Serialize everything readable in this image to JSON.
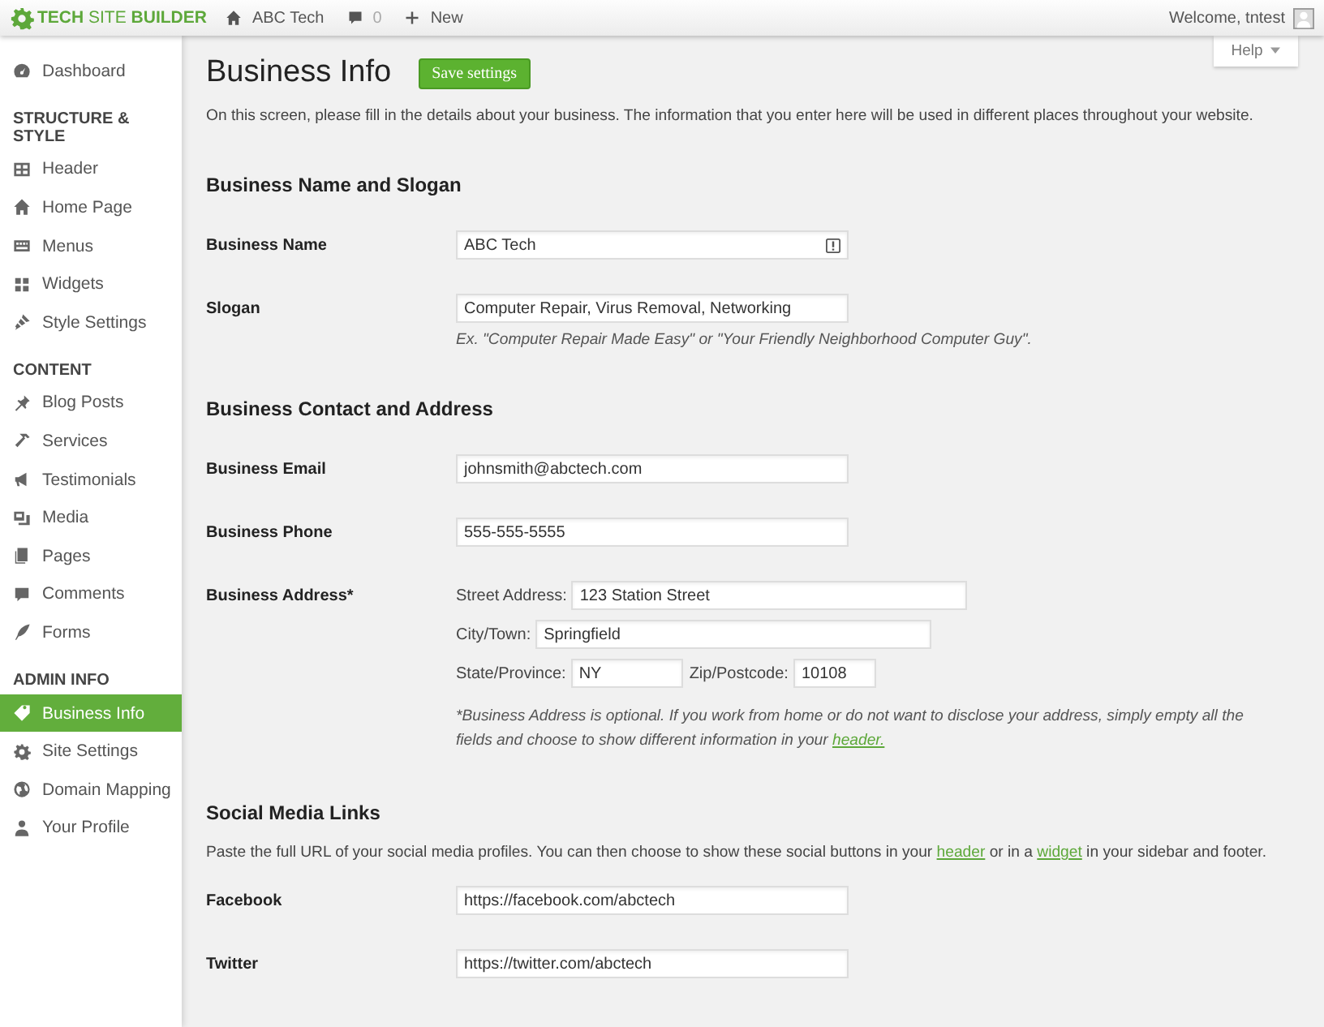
{
  "topbar": {
    "logo": "**TECH** SITE **BUILDER**",
    "site": "ABC Tech",
    "comments": "0",
    "new": "New",
    "welcome": "Welcome, tntest"
  },
  "help": "Help",
  "sidebar": {
    "items": [
      {
        "kind": "link",
        "label": "Dashboard",
        "selected": false
      },
      {
        "kind": "heading",
        "label": "STRUCTURE & STYLE"
      },
      {
        "kind": "link",
        "label": "Header",
        "selected": false
      },
      {
        "kind": "link",
        "label": "Home Page",
        "selected": false
      },
      {
        "kind": "link",
        "label": "Menus",
        "selected": false
      },
      {
        "kind": "link",
        "label": "Widgets",
        "selected": false
      },
      {
        "kind": "link",
        "label": "Style Settings",
        "selected": false
      },
      {
        "kind": "heading",
        "label": "CONTENT"
      },
      {
        "kind": "link",
        "label": "Blog Posts",
        "selected": false
      },
      {
        "kind": "link",
        "label": "Services",
        "selected": false
      },
      {
        "kind": "link",
        "label": "Testimonials",
        "selected": false
      },
      {
        "kind": "link",
        "label": "Media",
        "selected": false
      },
      {
        "kind": "link",
        "label": "Pages",
        "selected": false
      },
      {
        "kind": "link",
        "label": "Comments",
        "selected": false
      },
      {
        "kind": "link",
        "label": "Forms",
        "selected": false
      },
      {
        "kind": "heading",
        "label": "ADMIN INFO"
      },
      {
        "kind": "link",
        "label": "Business Info",
        "selected": true
      },
      {
        "kind": "link",
        "label": "Site Settings",
        "selected": false
      },
      {
        "kind": "link",
        "label": "Domain Mapping",
        "selected": false
      },
      {
        "kind": "link",
        "label": "Your Profile",
        "selected": false
      }
    ]
  },
  "page": {
    "title": "Business Info",
    "save_button": "Save settings",
    "intro": "On this screen, please fill in the details about your business. The information that you enter here will be used in different places throughout your website."
  },
  "sections": [
    {
      "heading": "Business Name and Slogan",
      "fields": [
        {
          "kind": "text",
          "label": "Business Name",
          "value": "ABC Tech"
        },
        {
          "kind": "text",
          "label": "Slogan",
          "value": "Computer Repair, Virus Removal, Networking",
          "hint": "Ex. \"Computer Repair Made Easy\" or \"Your Friendly Neighborhood Computer Guy\"."
        }
      ]
    },
    {
      "heading": "Business Contact and Address",
      "fields": [
        {
          "kind": "text",
          "label": "Business Email",
          "value": "johnsmith@abctech.com"
        },
        {
          "kind": "text",
          "label": "Business Phone",
          "value": "555-555-5555"
        },
        {
          "kind": "address",
          "label": "Business Address*",
          "lines": [
            [
              {
                "label": "Street Address:",
                "value": "123 Station Street"
              }
            ],
            [
              {
                "label": "City/Town:",
                "value": "Springfield"
              }
            ],
            [
              {
                "label": "State/Province:",
                "value": "NY"
              },
              {
                "label": "Zip/Postcode:",
                "value": "10108"
              }
            ]
          ],
          "note": [
            {
              "text": "*Business Address is optional. If you work from home or do not want to disclose your address, simply empty all the fields and choose to show different information in your "
            },
            {
              "link": "header."
            }
          ]
        }
      ]
    },
    {
      "heading": "Social Media Links",
      "description": [
        {
          "text": "Paste the full URL of your social media profiles. You can then choose to show these social buttons in your "
        },
        {
          "link": "header"
        },
        {
          "text": " or in a "
        },
        {
          "link": "widget"
        },
        {
          "text": " in your sidebar and footer."
        }
      ],
      "fields": [
        {
          "kind": "text",
          "label": "Facebook",
          "value": "https://facebook.com/abctech"
        },
        {
          "kind": "text",
          "label": "Twitter",
          "value": "https://twitter.com/abctech"
        }
      ]
    }
  ]
}
